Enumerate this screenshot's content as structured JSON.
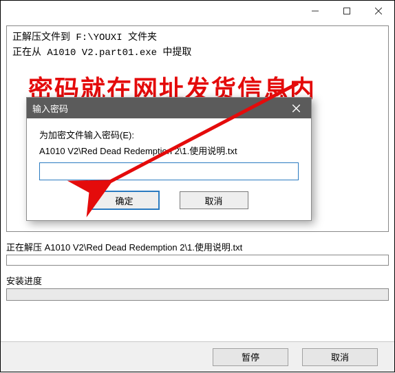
{
  "window": {
    "log_line1": "正解压文件到 F:\\YOUXI 文件夹",
    "log_line2": "正在从 A1010 V2.part01.exe 中提取"
  },
  "annotation": "密码就在网址发货信息内",
  "dialog": {
    "title": "输入密码",
    "prompt": "为加密文件输入密码(E):",
    "filepath": "A1010 V2\\Red Dead Redemption 2\\1.使用说明.txt",
    "input_value": "",
    "ok_label": "确定",
    "cancel_label": "取消"
  },
  "status": {
    "extracting_label": "正在解压",
    "extracting_file": "A1010 V2\\Red Dead Redemption 2\\1.使用说明.txt",
    "progress_label": "安装进度"
  },
  "footer": {
    "pause_label": "暂停",
    "cancel_label": "取消"
  }
}
